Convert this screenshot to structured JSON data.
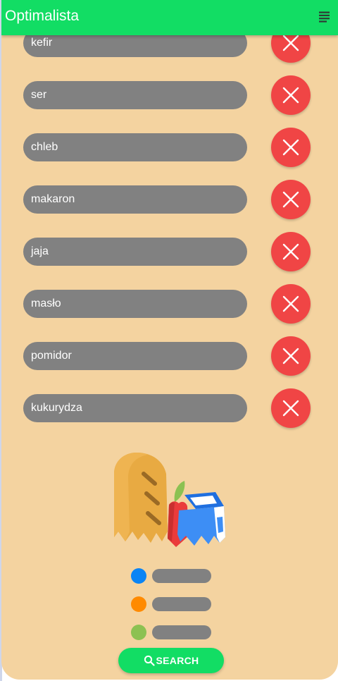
{
  "appbar": {
    "title": "Optimalista",
    "menu_icon": "notes-menu-icon"
  },
  "items": [
    {
      "label": "kefir"
    },
    {
      "label": "ser"
    },
    {
      "label": "chleb"
    },
    {
      "label": "makaron"
    },
    {
      "label": "jaja"
    },
    {
      "label": "masło"
    },
    {
      "label": "pomidor"
    },
    {
      "label": "kukurydza"
    }
  ],
  "delete_icon": "close-icon",
  "illustration": "grocery-bag-illustration",
  "legend": [
    {
      "color": "#0a84f5"
    },
    {
      "color": "#ff8a00"
    },
    {
      "color": "#8cc152"
    }
  ],
  "search": {
    "label": "SEARCH",
    "icon": "search-icon"
  },
  "colors": {
    "appbar": "#12dd64",
    "background": "#f4d3a0",
    "pill": "#818181",
    "delete": "#f04545"
  }
}
